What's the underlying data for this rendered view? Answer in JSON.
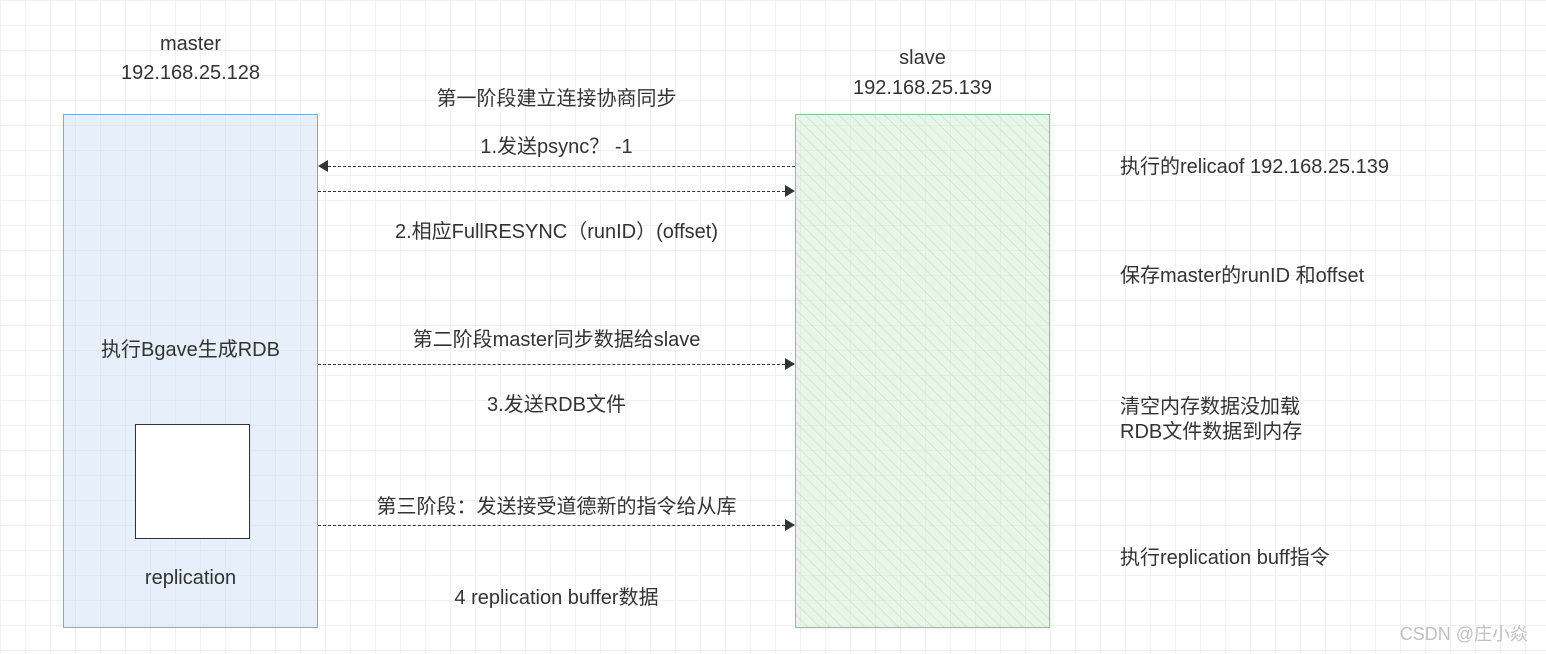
{
  "master": {
    "title1": "master",
    "title2": "192.168.25.128",
    "bgsave": "执行Bgave生成RDB",
    "replication": "replication"
  },
  "slave": {
    "title1": "slave",
    "title2": "192.168.25.139"
  },
  "phases": {
    "phase1": "第一阶段建立连接协商同步",
    "step1": "1.发送psync？ -1",
    "step2": "2.相应FullRESYNC（runID）(offset)",
    "phase2": "第二阶段master同步数据给slave",
    "step3": "3.发送RDB文件",
    "phase3": "第三阶段：发送接受道德新的指令给从库",
    "step4": "4 replication buffer数据"
  },
  "notes": {
    "n1": "执行的relicaof 192.168.25.139",
    "n2": "保存master的runID 和offset",
    "n3_1": "清空内存数据没加载",
    "n3_2": "RDB文件数据到内存",
    "n4": "执行replication buff指令"
  },
  "watermark": "CSDN @庄小焱"
}
